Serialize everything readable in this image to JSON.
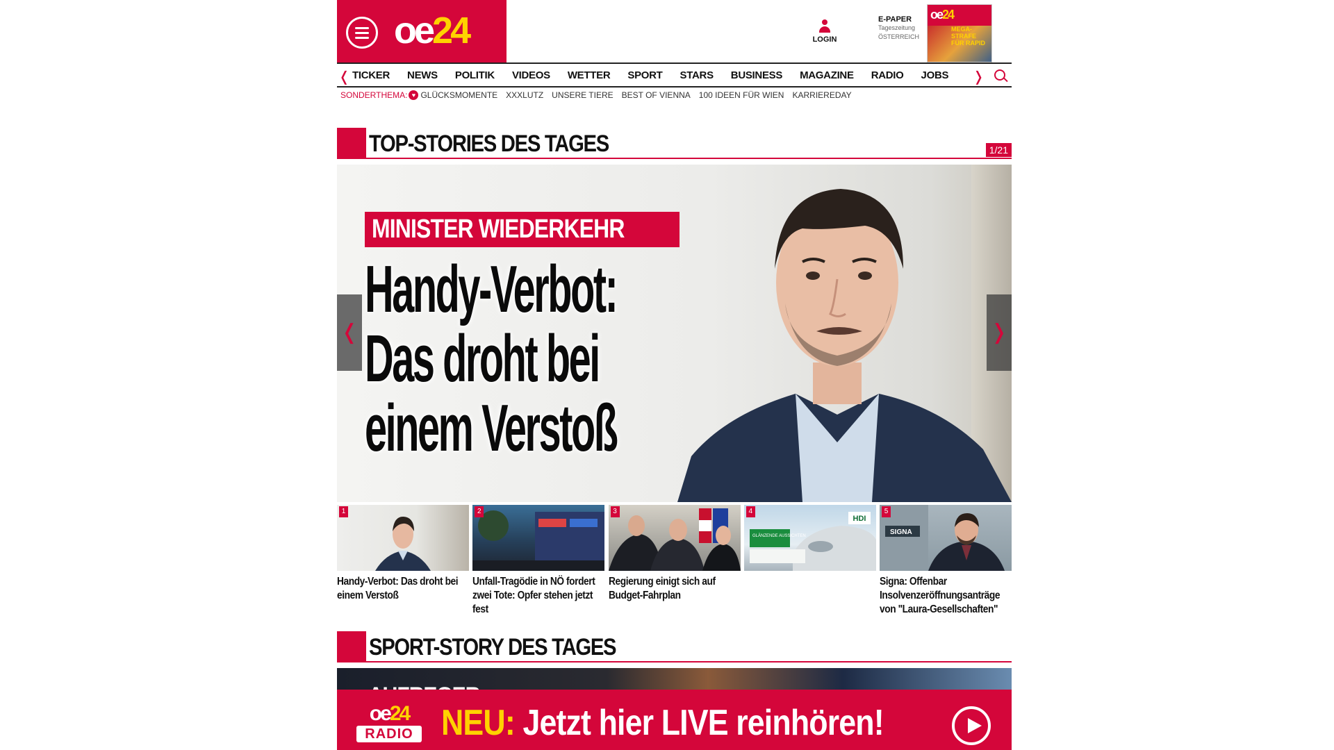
{
  "header": {
    "logo_part1": "oe",
    "logo_part2": "24",
    "login_label": "LOGIN",
    "epaper_title": "E-PAPER",
    "epaper_sub1": "Tageszeitung",
    "epaper_sub2": "ÖSTERREICH",
    "epaper_cover_text": "MEGA-STRAFE FÜR RAPID"
  },
  "nav": {
    "prev_arrow": "❬",
    "next_arrow": "❭",
    "items": [
      "TICKER",
      "NEWS",
      "POLITIK",
      "VIDEOS",
      "WETTER",
      "SPORT",
      "STARS",
      "BUSINESS",
      "MAGAZINE",
      "RADIO",
      "JOBS"
    ]
  },
  "subnav": {
    "label": "SONDERTHEMA:",
    "items": [
      "GLÜCKSMOMENTE",
      "XXXLUTZ",
      "UNSERE TIERE",
      "BEST OF VIENNA",
      "100 IDEEN FÜR WIEN",
      "KARRIEREDAY"
    ]
  },
  "top_stories": {
    "title": "TOP-STORIES DES TAGES",
    "counter": "1/21",
    "hero": {
      "kicker": "MINISTER WIEDERKEHR",
      "headline_lines": [
        "Handy-Verbot:",
        "Das droht bei",
        "einem Verstoß"
      ],
      "prev_arrow": "❬",
      "next_arrow": "❭"
    },
    "thumbs": [
      {
        "num": "1",
        "title": "Handy-Verbot: Das droht bei einem Verstoß"
      },
      {
        "num": "2",
        "title": "Unfall-Tragödie in NÖ fordert zwei Tote: Opfer stehen jetzt fest"
      },
      {
        "num": "3",
        "title": "Regierung einigt sich auf Budget-Fahrplan"
      },
      {
        "num": "4",
        "title": ""
      },
      {
        "num": "5",
        "title": "Signa: Offenbar Insolvenzeröffnungsanträge von \"Laura-Gesellschaften\""
      }
    ],
    "thumb4_ad": {
      "brand": "HDI",
      "tag": "GLÄNZENDE AUSSICHTEN"
    },
    "thumb5_sign": "SIGNA"
  },
  "sport_story": {
    "title": "SPORT-STORY DES TAGES",
    "teaser_text": "AUFREGER"
  },
  "radio_banner": {
    "logo_part1": "oe",
    "logo_part2": "24",
    "logo_tag": "RADIO",
    "neu": "NEU:",
    "text": " Jetzt hier LIVE reinhören!"
  },
  "colors": {
    "brand_red": "#d4063a",
    "brand_yellow": "#ffd200"
  }
}
